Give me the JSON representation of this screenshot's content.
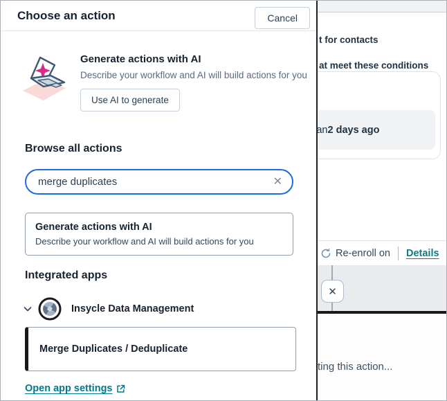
{
  "modal": {
    "title": "Choose an action",
    "cancel_label": "Cancel",
    "ai_hero": {
      "title": "Generate actions with AI",
      "description": "Describe your workflow and AI will build actions for you",
      "button_label": "Use AI to generate"
    },
    "browse_heading": "Browse all actions",
    "search": {
      "value": "merge duplicates"
    },
    "ai_card": {
      "title": "Generate actions with AI",
      "description": "Describe your workflow and AI will build actions for you"
    },
    "integrated_apps_heading": "Integrated apps",
    "app_group_name": "Insycle Data Management",
    "action_label": "Merge Duplicates / Deduplicate",
    "open_app_settings_label": "Open app settings"
  },
  "background": {
    "enrollment_line": "t for contacts",
    "conditions_line": "at meet these conditions",
    "condition_text_prefix": "s than ",
    "condition_text_bold": "2 days ago",
    "reenroll_label": "Re-enroll on",
    "details_label": "Details",
    "status_text": "ting this action..."
  },
  "icons": {
    "search_clear": "✕",
    "close": "✕"
  },
  "colors": {
    "accent_blue": "#1e6ae1",
    "link_teal": "#007a8c",
    "text_dark": "#213343",
    "border_gray": "#c6d0da",
    "black_bar": "#17191c"
  }
}
